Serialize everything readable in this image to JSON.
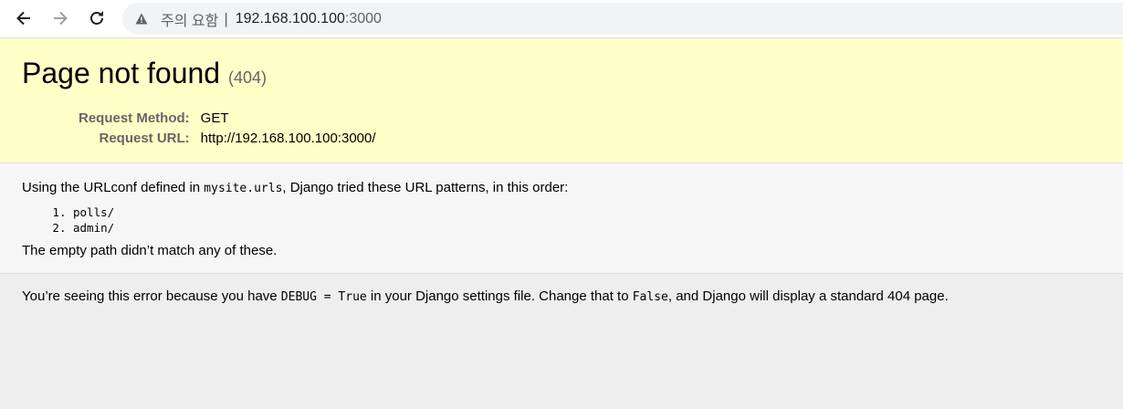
{
  "browser": {
    "back_icon": "arrow-left-icon",
    "forward_icon": "arrow-right-icon",
    "reload_icon": "reload-icon",
    "security_warning_text": "주의 요함",
    "separator": "|",
    "url_host": "192.168.100.100",
    "url_port": ":3000"
  },
  "summary": {
    "title": "Page not found",
    "status_code": "(404)",
    "request_method_label": "Request Method:",
    "request_method_value": "GET",
    "request_url_label": "Request URL:",
    "request_url_value": "http://192.168.100.100:3000/"
  },
  "info": {
    "intro_before": "Using the URLconf defined in ",
    "urlconf": "mysite.urls",
    "intro_after": ", Django tried these URL patterns, in this order:",
    "patterns": [
      "polls/",
      "admin/"
    ],
    "no_match": "The empty path didn’t match any of these."
  },
  "explanation": {
    "text_1": "You’re seeing this error because you have ",
    "debug_code": "DEBUG = True",
    "text_2": " in your Django settings file. Change that to ",
    "false_code": "False",
    "text_3": ", and Django will display a standard 404 page."
  },
  "colors": {
    "summary_bg": "#ffffc8",
    "info_bg": "#f6f6f6",
    "explanation_bg": "#eeeeee"
  }
}
